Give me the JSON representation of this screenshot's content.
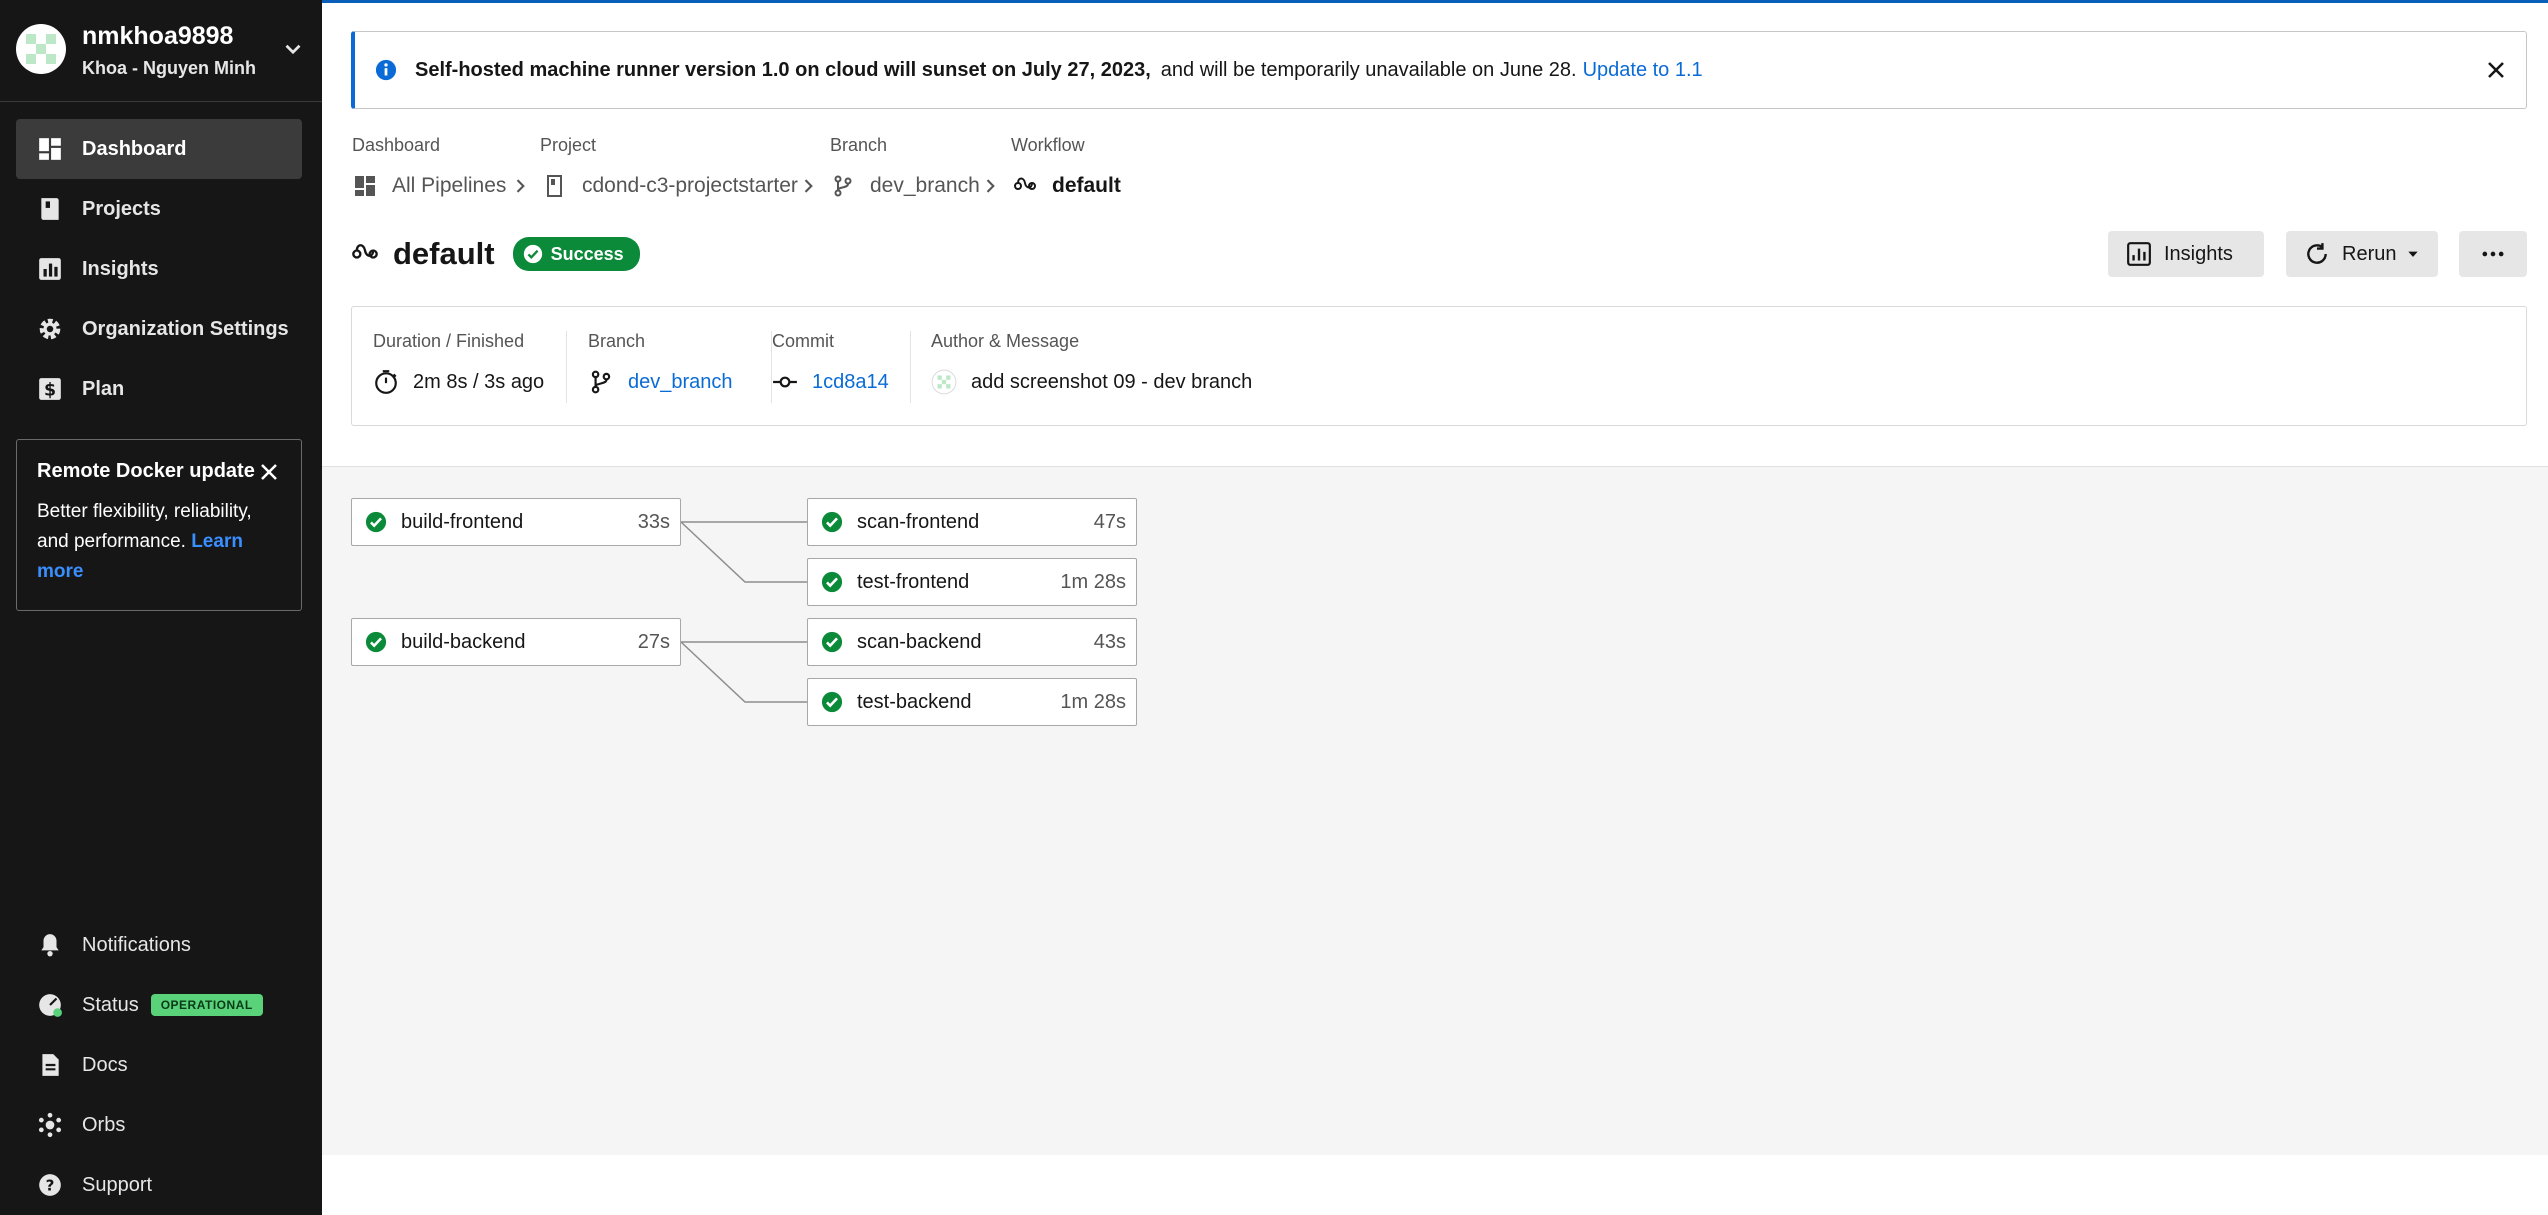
{
  "user": {
    "username": "nmkhoa9898",
    "full_name": "Khoa - Nguyen Minh"
  },
  "sidebar": {
    "items": [
      {
        "label": "Dashboard",
        "icon": "dashboard-icon",
        "active": true
      },
      {
        "label": "Projects",
        "icon": "projects-icon"
      },
      {
        "label": "Insights",
        "icon": "insights-icon"
      },
      {
        "label": "Organization Settings",
        "icon": "gear-icon"
      },
      {
        "label": "Plan",
        "icon": "dollar-icon"
      }
    ],
    "promo": {
      "title": "Remote Docker update",
      "body": "Better flexibility, reliability, and performance.",
      "link": "Learn more"
    },
    "bottom": [
      {
        "label": "Notifications",
        "icon": "bell-icon"
      },
      {
        "label": "Status",
        "icon": "status-icon",
        "badge": "OPERATIONAL"
      },
      {
        "label": "Docs",
        "icon": "docs-icon"
      },
      {
        "label": "Orbs",
        "icon": "orbs-icon"
      },
      {
        "label": "Support",
        "icon": "help-icon"
      }
    ]
  },
  "banner": {
    "bold": "Self-hosted machine runner version 1.0 on cloud will sunset on July 27, 2023,",
    "text": "and will be temporarily unavailable on June 28.",
    "link": "Update to 1.1"
  },
  "breadcrumb": {
    "dashboard": {
      "label": "Dashboard",
      "value": "All Pipelines"
    },
    "project": {
      "label": "Project",
      "value": "cdond-c3-projectstarter"
    },
    "branch": {
      "label": "Branch",
      "value": "dev_branch"
    },
    "workflow": {
      "label": "Workflow",
      "value": "default"
    }
  },
  "workflow": {
    "name": "default",
    "status": "Success",
    "buttons": {
      "insights": "Insights",
      "rerun": "Rerun"
    }
  },
  "summary": {
    "duration": {
      "label": "Duration / Finished",
      "value": "2m 8s / 3s ago"
    },
    "branch": {
      "label": "Branch",
      "value": "dev_branch"
    },
    "commit": {
      "label": "Commit",
      "value": "1cd8a14"
    },
    "author": {
      "label": "Author & Message",
      "value": "add screenshot 09 - dev branch"
    }
  },
  "jobs": [
    {
      "name": "build-frontend",
      "duration": "33s",
      "status": "success"
    },
    {
      "name": "scan-frontend",
      "duration": "47s",
      "status": "success"
    },
    {
      "name": "test-frontend",
      "duration": "1m 28s",
      "status": "success"
    },
    {
      "name": "build-backend",
      "duration": "27s",
      "status": "success"
    },
    {
      "name": "scan-backend",
      "duration": "43s",
      "status": "success"
    },
    {
      "name": "test-backend",
      "duration": "1m 28s",
      "status": "success"
    }
  ],
  "colors": {
    "accent": "#0a6bd6",
    "success": "#0b8a3a",
    "sidebar": "#161616",
    "operational": "#59d27a"
  }
}
